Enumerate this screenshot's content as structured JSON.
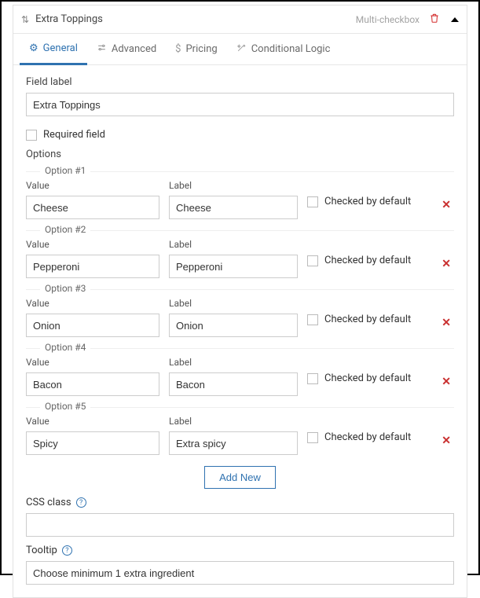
{
  "header": {
    "title": "Extra Toppings",
    "type_label": "Multi-checkbox"
  },
  "tabs": {
    "general": "General",
    "advanced": "Advanced",
    "pricing": "Pricing",
    "conditional": "Conditional Logic"
  },
  "general": {
    "field_label_label": "Field label",
    "field_label_value": "Extra Toppings",
    "required_label": "Required field",
    "options_label": "Options",
    "value_header": "Value",
    "label_header": "Label",
    "checked_default_label": "Checked by default",
    "add_new_label": "Add New",
    "options": [
      {
        "legend": "Option #1",
        "value": "Cheese",
        "label": "Cheese"
      },
      {
        "legend": "Option #2",
        "value": "Pepperoni",
        "label": "Pepperoni"
      },
      {
        "legend": "Option #3",
        "value": "Onion",
        "label": "Onion"
      },
      {
        "legend": "Option #4",
        "value": "Bacon",
        "label": "Bacon"
      },
      {
        "legend": "Option #5",
        "value": "Spicy",
        "label": "Extra spicy"
      }
    ],
    "css_class_label": "CSS class",
    "css_class_value": "",
    "tooltip_label": "Tooltip",
    "tooltip_value": "Choose minimum 1 extra ingredient"
  },
  "icons": {
    "remove": "✕"
  }
}
